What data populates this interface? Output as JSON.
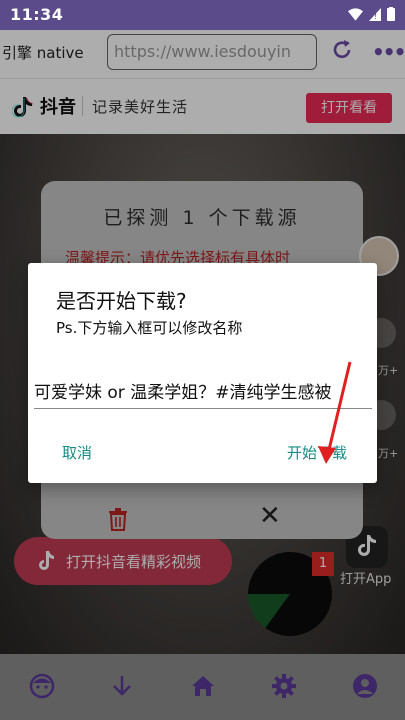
{
  "status_bar": {
    "time": "11:34",
    "icons": [
      "wifi-icon",
      "signal-icon",
      "battery-icon"
    ]
  },
  "toolbar": {
    "engine_label": "引擎 native",
    "url_value": "https://www.iesdouyin",
    "refresh_icon": "refresh-icon",
    "more_icon": "more-icon"
  },
  "douyin_header": {
    "brand": "抖音",
    "slogan": "记录美好生活",
    "open_button": "打开看看"
  },
  "detect_dialog": {
    "title": "已探测 1 个下载源",
    "tip": "温馨提示：请优先选择标有具体时"
  },
  "video": {
    "open_douyin_label": "打开抖音看精彩视频",
    "open_app_label": "打开App",
    "badge_count": "1",
    "side_counts": [
      "万+",
      "万+"
    ]
  },
  "download_dialog": {
    "title": "是否开始下载?",
    "message": "Ps.下方输入框可以修改名称",
    "input_value": "可爱学妹 or 温柔学姐？#清纯学生感被",
    "cancel_label": "取消",
    "start_label": "开始下载"
  },
  "bottom_nav": {
    "items": [
      "face-icon",
      "download-icon",
      "home-icon",
      "settings-icon",
      "account-icon"
    ]
  },
  "colors": {
    "accent": "#6a4aa8",
    "dialog_button": "#148b84",
    "douyin_red": "#ea2a58",
    "tip_red": "#b22222",
    "arrow": "#e02020"
  }
}
